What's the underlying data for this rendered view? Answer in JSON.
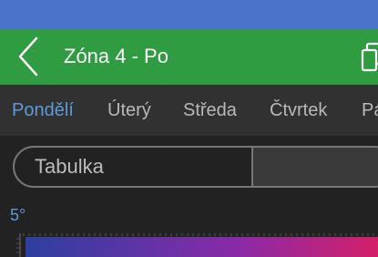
{
  "colors": {
    "status_bar": "#4a74c9",
    "app_bar": "#2f9c42",
    "background": "#222222",
    "tabs_background": "#313131",
    "tab_active": "#5b9bd8",
    "tab_inactive": "#b8b8b8",
    "gradient_start": "#2c3fa0",
    "gradient_mid": "#8a2aa8",
    "gradient_end": "#d42068"
  },
  "header": {
    "title": "Zóna 4 - Po",
    "back_icon": "chevron-left-icon",
    "action_icon": "copy-icon"
  },
  "tabs": [
    {
      "label": "Pondělí",
      "active": true
    },
    {
      "label": "Úterý",
      "active": false
    },
    {
      "label": "Středa",
      "active": false
    },
    {
      "label": "Čtvrtek",
      "active": false
    },
    {
      "label": "Pá",
      "active": false
    }
  ],
  "view_toggle": {
    "selected": "Tabulka"
  },
  "temperature": {
    "label": "5°"
  }
}
